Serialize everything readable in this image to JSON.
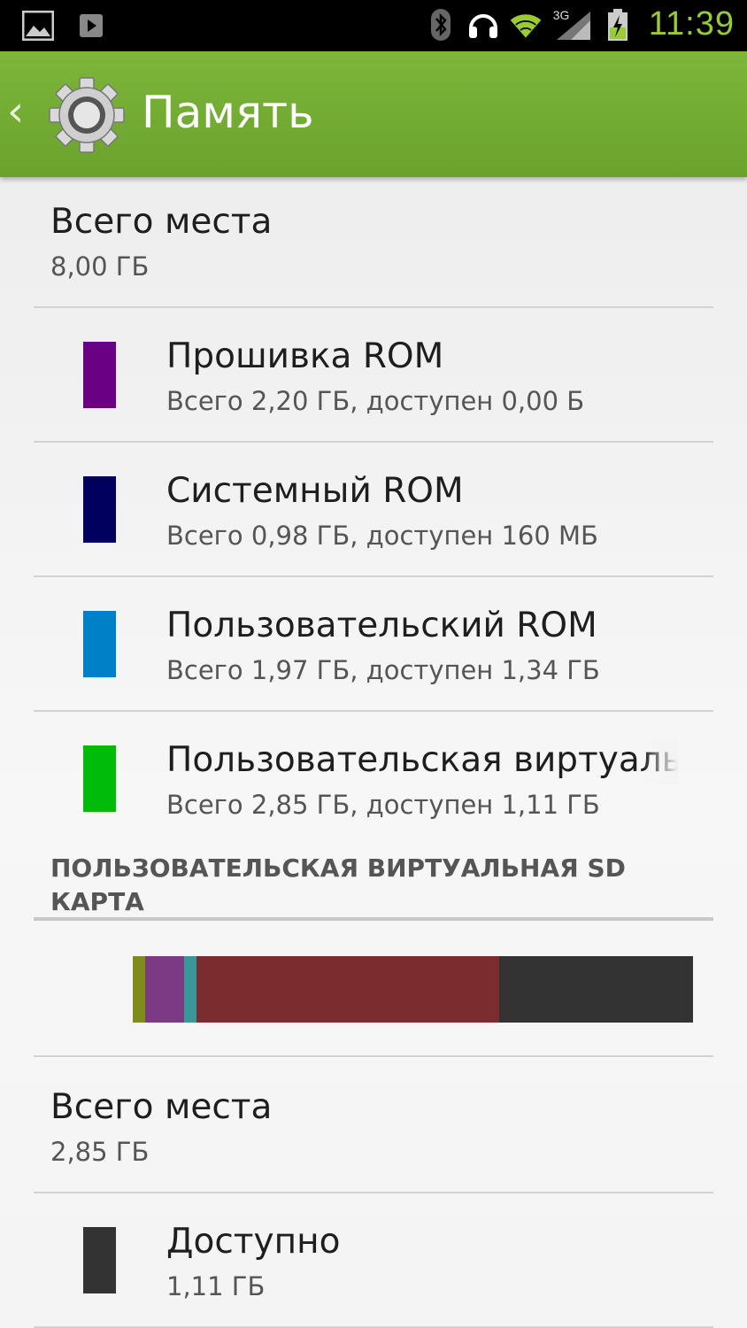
{
  "status_bar": {
    "time": "11:39",
    "network": "3G",
    "icons": [
      "gallery-icon",
      "play-store-icon",
      "bluetooth-icon",
      "headset-icon",
      "wifi-icon",
      "signal-icon",
      "battery-charging-icon"
    ]
  },
  "action_bar": {
    "title": "Память",
    "icon": "settings-gear-icon",
    "up": "back-chevron-icon"
  },
  "internal": {
    "total": {
      "label": "Всего места",
      "value": "8,00 ГБ"
    },
    "items": [
      {
        "label": "Прошивка ROM",
        "detail": "Всего 2,20 ГБ, доступен 0,00 Б",
        "color": "#6a0184"
      },
      {
        "label": "Системный ROM",
        "detail": "Всего 0,98 ГБ, доступен 160 МБ",
        "color": "#01005e"
      },
      {
        "label": "Пользовательский ROM",
        "detail": "Всего 1,97 ГБ, доступен 1,34 ГБ",
        "color": "#0080c6"
      },
      {
        "label": "Пользовательская виртуальн",
        "detail": "Всего 2,85 ГБ, доступен 1,11 ГБ",
        "color": "#00bb09"
      }
    ]
  },
  "sd_section": {
    "header": "ПОЛЬЗОВАТЕЛЬСКАЯ ВИРТУАЛЬНАЯ SD КАРТА",
    "usage_bar": [
      {
        "name": "segment-1",
        "color": "#7f8c1a",
        "fraction": 0.022
      },
      {
        "name": "segment-2",
        "color": "#7b3a83",
        "fraction": 0.07
      },
      {
        "name": "segment-3",
        "color": "#3b9698",
        "fraction": 0.022
      },
      {
        "name": "segment-4",
        "color": "#7b2c2f",
        "fraction": 0.54
      },
      {
        "name": "available",
        "color": "#333333",
        "fraction": 0.346
      }
    ],
    "total": {
      "label": "Всего места",
      "value": "2,85 ГБ"
    },
    "available": {
      "label": "Доступно",
      "value": "1,11 ГБ",
      "color": "#333333"
    }
  }
}
